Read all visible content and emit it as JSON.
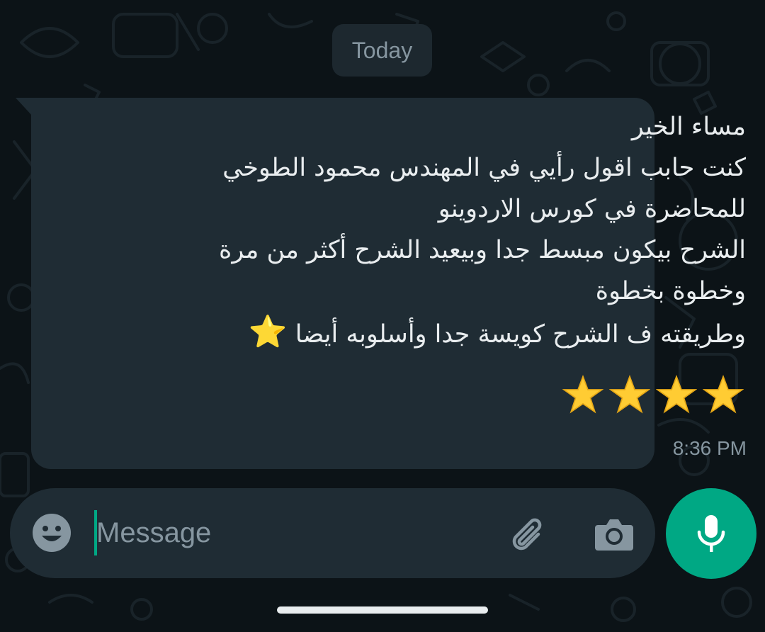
{
  "date_chip": "Today",
  "message": {
    "lines": [
      "مساء الخير",
      "كنت حابب اقول رأيي في المهندس محمود الطوخي",
      "للمحاضرة في كورس الاردوينو",
      "الشرح بيكون مبسط جدا وبيعيد الشرح أكثر من مرة",
      "وخطوة بخطوة",
      "وطريقته ف الشرح كويسة جدا وأسلوبه أيضا"
    ],
    "line6_star": "⭐",
    "rating_stars": [
      "⭐",
      "⭐",
      "⭐",
      "⭐"
    ],
    "time": "8:36 PM"
  },
  "composer": {
    "placeholder": "Message",
    "emoji_icon": "emoji-icon",
    "attach_icon": "paperclip-icon",
    "camera_icon": "camera-icon",
    "mic_icon": "microphone-icon"
  },
  "colors": {
    "background": "#0c1317",
    "bubble": "#1f2c34",
    "accent": "#00a884",
    "text": "#e9edef",
    "muted": "#8696a0",
    "star": "#ffcc33"
  }
}
